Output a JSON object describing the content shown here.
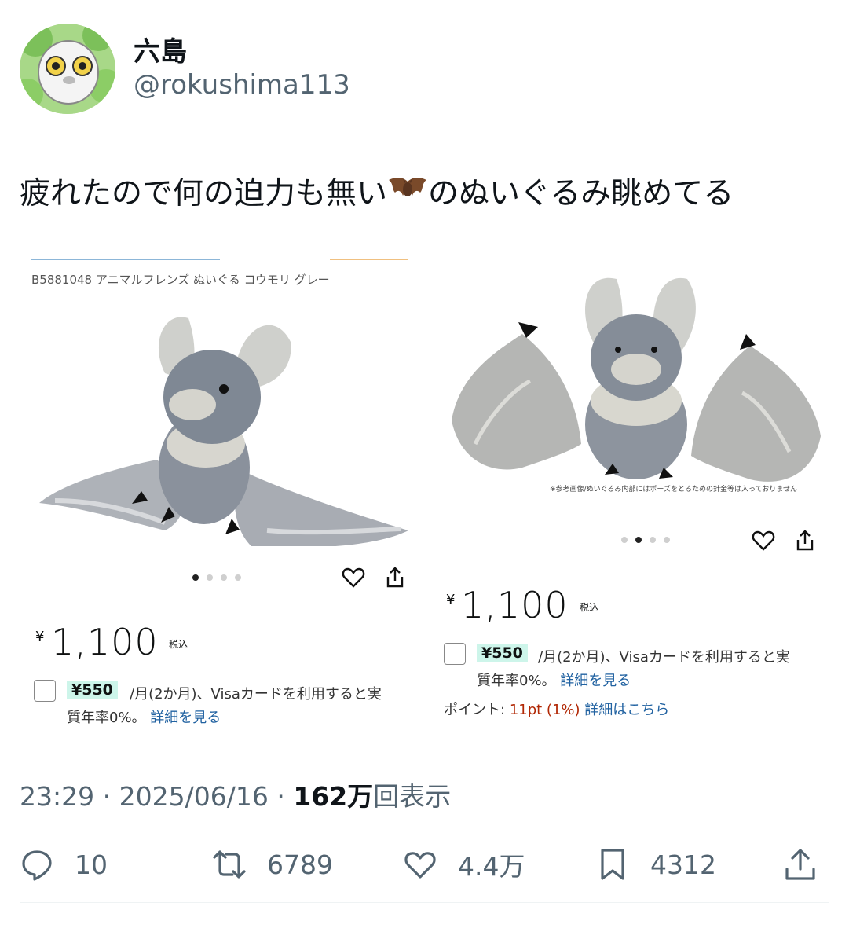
{
  "user": {
    "display_name": "六島",
    "handle": "@rokushima113"
  },
  "tweet": {
    "text_before": "疲れたので何の迫力も無い",
    "emoji": "bat-emoji",
    "text_after": "のぬいぐるみ眺めてる"
  },
  "media": {
    "left": {
      "product_id": "B5881048 アニマルフレンズ ぬいぐる コウモリ グレー",
      "yen": "¥",
      "price": "1,100",
      "tax": "税込",
      "installment_amount": "¥550",
      "installment_text": "/月(2か月)、Visaカードを利用すると実",
      "installment_text2": "質年率0%。",
      "details_link": "詳細を見る"
    },
    "right": {
      "note": "※参考画像/ぬいぐるみ内部にはポーズをとるための針金等は入っておりません",
      "yen": "¥",
      "price": "1,100",
      "tax": "税込",
      "installment_amount": "¥550",
      "installment_text": "/月(2か月)、Visaカードを利用すると実",
      "installment_text2": "質年率0%。",
      "details_link": "詳細を見る",
      "points_label": "ポイント:",
      "points_value": "11pt (1%)",
      "points_link": "詳細はこちら"
    }
  },
  "meta": {
    "time": "23:29",
    "sep": "·",
    "date": "2025/06/16",
    "views_count": "162万",
    "views_label": "回表示"
  },
  "actions": {
    "replies": "10",
    "retweets": "6789",
    "likes": "4.4万",
    "bookmarks": "4312"
  },
  "colors": {
    "text_primary": "#0f1419",
    "text_secondary": "#536471",
    "link": "#2162a1",
    "points_red": "#b12704",
    "highlight_bg": "#cdf5ea"
  }
}
